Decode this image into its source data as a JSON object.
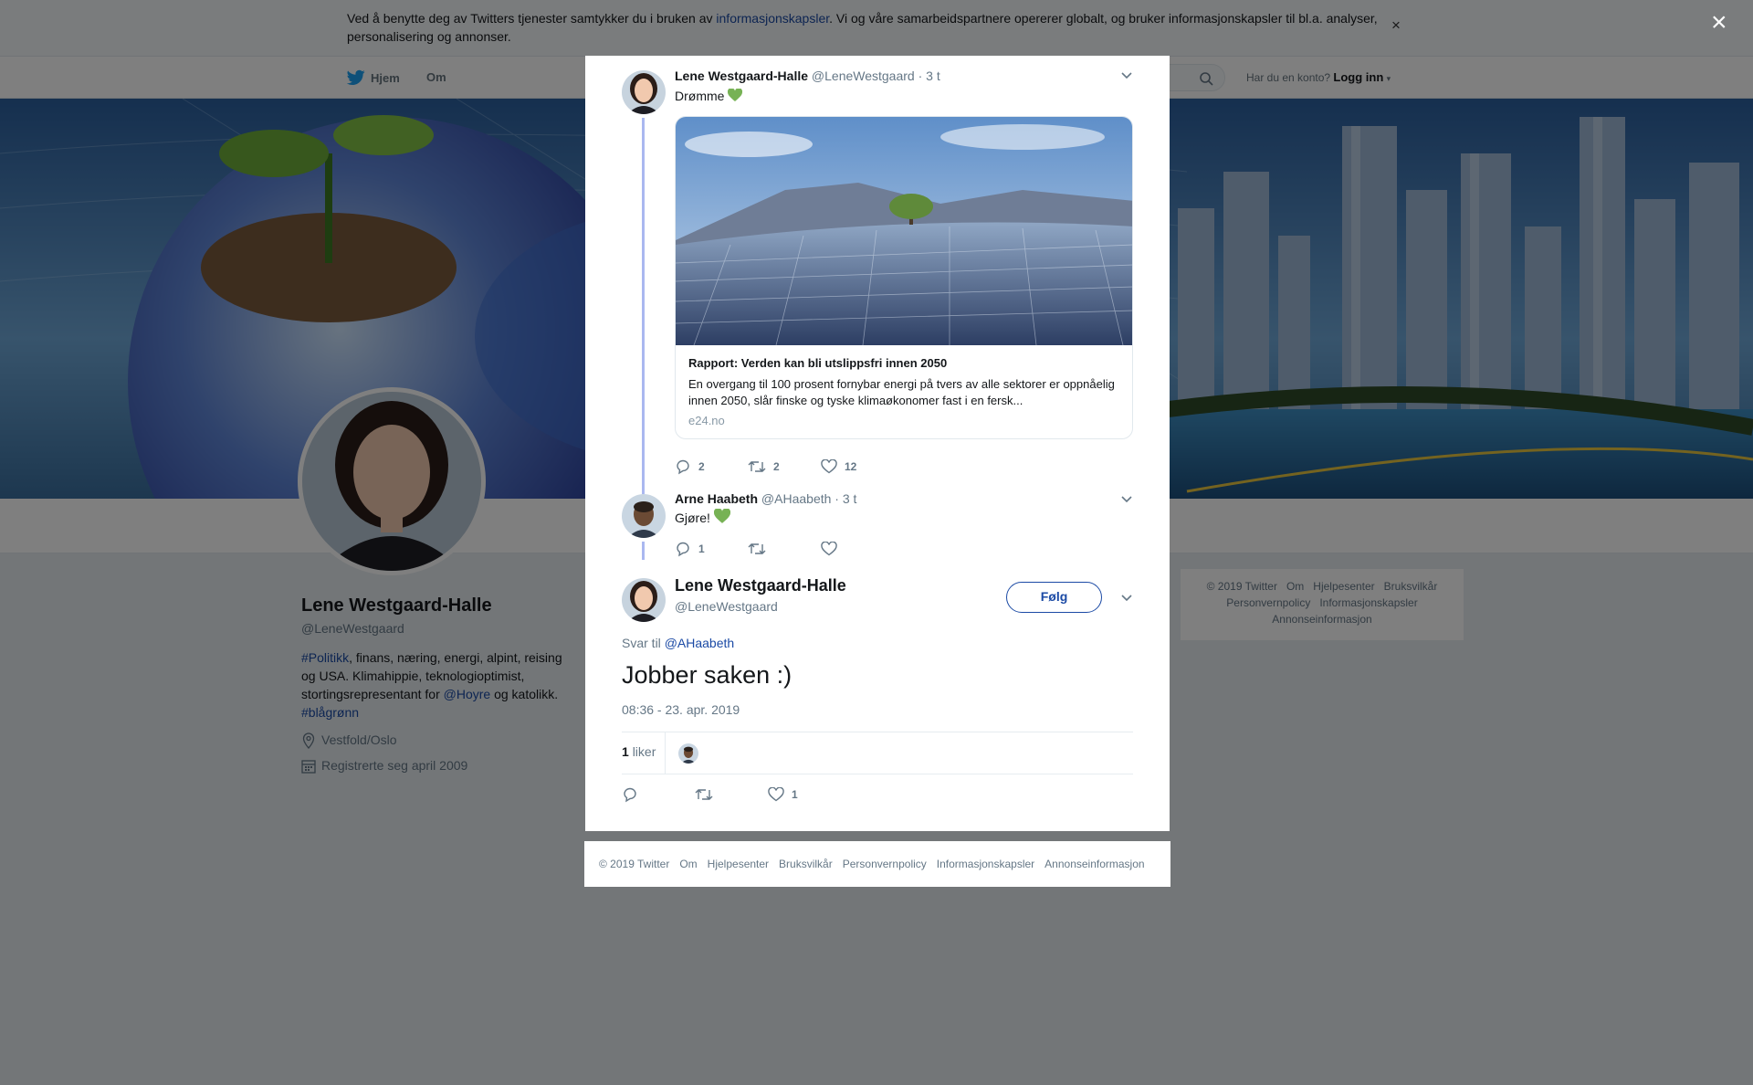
{
  "cookie_banner": {
    "text_before": "Ved å benytte deg av Twitters tjenester samtykker du i bruken av ",
    "link": "informasjonskapsler",
    "text_after": ". Vi og våre samarbeidspartnere opererer globalt, og bruker informasjonskapsler til bl.a. analyser, personalisering og annonser.",
    "close": "×"
  },
  "nav": {
    "home": "Hjem",
    "about": "Om",
    "account_prompt": "Har du en konto?",
    "login": "Logg inn"
  },
  "profile": {
    "name": "Lene Westgaard-Halle",
    "handle": "@LeneWestgaard",
    "bio": {
      "tag1": "#Politikk",
      "text1": ", finans, næring, energi, alpint, reising og USA. Klimahippie, teknologioptimist, stortingsrepresentant for ",
      "mention": "@Hoyre",
      "text2": " og katolikk. ",
      "tag2": "#blågrønn"
    },
    "location": "Vestfold/Oslo",
    "joined": "Registrerte seg april 2009"
  },
  "side_footer": [
    "© 2019 Twitter",
    "Om",
    "Hjelpesenter",
    "Bruksvilkår",
    "Personvernpolicy",
    "Informasjonskapsler",
    "Annonseinformasjon"
  ],
  "overlay_close": "×",
  "thread": {
    "tweet1": {
      "name": "Lene Westgaard-Halle",
      "handle": "@LeneWestgaard",
      "time": "· 3 t",
      "text": "Drømme",
      "card": {
        "title": "Rapport: Verden kan bli utslippsfri innen 2050",
        "description": "En overgang til 100 prosent fornybar energi på tvers av alle sektorer er oppnåelig innen 2050, slår finske og tyske klimaøkonomer fast i en fersk...",
        "domain": "e24.no"
      },
      "replies": "2",
      "retweets": "2",
      "likes": "12"
    },
    "tweet2": {
      "name": "Arne Haabeth",
      "handle": "@AHaabeth",
      "time": "· 3 t",
      "text": "Gjøre!",
      "replies": "1",
      "retweets": "",
      "likes": ""
    },
    "main": {
      "name": "Lene Westgaard-Halle",
      "handle": "@LeneWestgaard",
      "follow": "Følg",
      "reply_prefix": "Svar til ",
      "reply_to": "@AHaabeth",
      "text": "Jobber saken :)",
      "timestamp": "08:36 - 23. apr. 2019",
      "likes_count": "1",
      "likes_label": "liker",
      "replies": "",
      "retweets": "",
      "likes": "1"
    }
  },
  "modal_footer": [
    "© 2019 Twitter",
    "Om",
    "Hjelpesenter",
    "Bruksvilkår",
    "Personvernpolicy",
    "Informasjonskapsler",
    "Annonseinformasjon"
  ],
  "colors": {
    "link": "#1b4aa5",
    "thread_line": "#aab8f0",
    "heart_emoji": "#77b255",
    "twitter_blue": "#1da1f2"
  }
}
